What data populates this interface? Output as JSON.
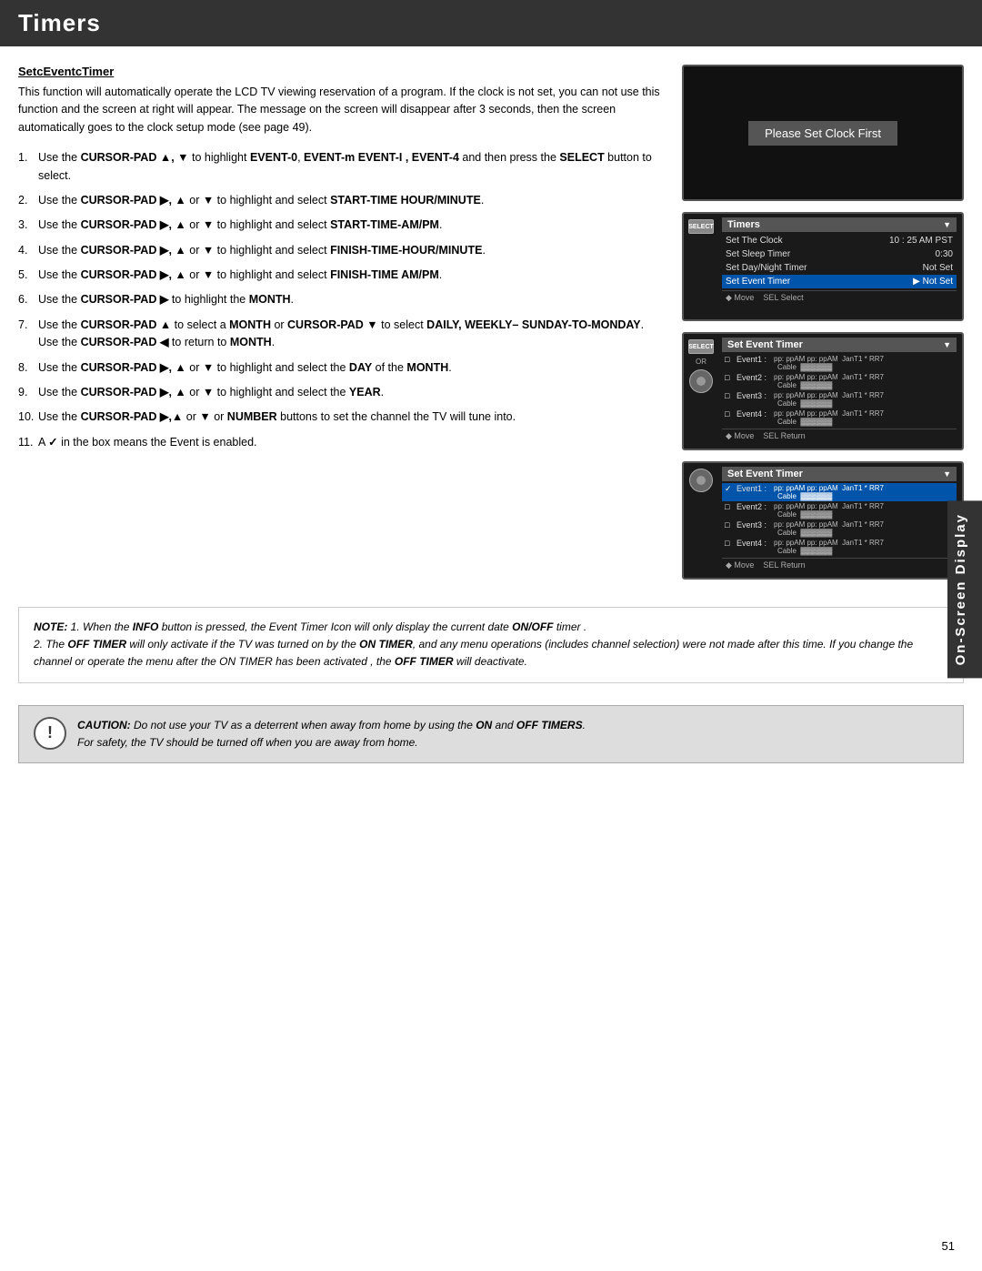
{
  "header": {
    "title": "Timers"
  },
  "sidebar": {
    "label": "On-Screen Display"
  },
  "section": {
    "title": "SetcEventcTimer",
    "intro": "This function will automatically operate the LCD TV viewing reservation of a program. If the clock is not set, you can not use this function and the screen at right will appear. The message on the screen will disappear after 3 seconds, then the screen automatically goes to the clock setup mode (see page 49)."
  },
  "steps": [
    {
      "num": "1.",
      "text_parts": [
        {
          "type": "normal",
          "text": "Use the "
        },
        {
          "type": "bold",
          "text": "CURSOR-PAD ▲, ▼"
        },
        {
          "type": "normal",
          "text": " to highlight "
        },
        {
          "type": "bold",
          "text": "EVENT-0"
        },
        {
          "type": "normal",
          "text": ", "
        },
        {
          "type": "bold",
          "text": "EVENT-m EVENT-I , EVENT-4"
        },
        {
          "type": "normal",
          "text": " and then press the "
        },
        {
          "type": "bold",
          "text": "SELECT"
        },
        {
          "type": "normal",
          "text": " button to select."
        }
      ]
    },
    {
      "num": "2.",
      "text_parts": [
        {
          "type": "normal",
          "text": "Use the "
        },
        {
          "type": "bold",
          "text": "CURSOR-PAD ▶, ▲"
        },
        {
          "type": "normal",
          "text": " or "
        },
        {
          "type": "bold",
          "text": "▼"
        },
        {
          "type": "normal",
          "text": " to highlight and select "
        },
        {
          "type": "bold",
          "text": "START-TIME HOUR/MINUTE"
        },
        {
          "type": "normal",
          "text": "."
        }
      ]
    },
    {
      "num": "3.",
      "text_parts": [
        {
          "type": "normal",
          "text": "Use the "
        },
        {
          "type": "bold",
          "text": "CURSOR-PAD ▶, ▲"
        },
        {
          "type": "normal",
          "text": " or "
        },
        {
          "type": "bold",
          "text": "▼"
        },
        {
          "type": "normal",
          "text": " to highlight and select "
        },
        {
          "type": "bold",
          "text": "START-TIME-AM/PM"
        },
        {
          "type": "normal",
          "text": "."
        }
      ]
    },
    {
      "num": "4.",
      "text_parts": [
        {
          "type": "normal",
          "text": "Use the "
        },
        {
          "type": "bold",
          "text": "CURSOR-PAD ▶, ▲"
        },
        {
          "type": "normal",
          "text": " or "
        },
        {
          "type": "bold",
          "text": "▼"
        },
        {
          "type": "normal",
          "text": " to highlight and select "
        },
        {
          "type": "bold",
          "text": "FINISH-TIME-HOUR/MINUTE"
        },
        {
          "type": "normal",
          "text": "."
        }
      ]
    },
    {
      "num": "5.",
      "text_parts": [
        {
          "type": "normal",
          "text": "Use the "
        },
        {
          "type": "bold",
          "text": "CURSOR-PAD ▶, ▲"
        },
        {
          "type": "normal",
          "text": " or "
        },
        {
          "type": "bold",
          "text": "▼"
        },
        {
          "type": "normal",
          "text": " to highlight and select "
        },
        {
          "type": "bold",
          "text": "FINISH-TIME AM/PM"
        },
        {
          "type": "normal",
          "text": "."
        }
      ]
    },
    {
      "num": "6.",
      "text_parts": [
        {
          "type": "normal",
          "text": "Use the "
        },
        {
          "type": "bold",
          "text": "CURSOR-PAD ▶"
        },
        {
          "type": "normal",
          "text": " to highlight the "
        },
        {
          "type": "bold",
          "text": "MONTH"
        },
        {
          "type": "normal",
          "text": "."
        }
      ]
    },
    {
      "num": "7.",
      "text_parts": [
        {
          "type": "normal",
          "text": "Use the "
        },
        {
          "type": "bold",
          "text": "CURSOR-PAD ▲"
        },
        {
          "type": "normal",
          "text": " to select a "
        },
        {
          "type": "bold",
          "text": "MONTH"
        },
        {
          "type": "normal",
          "text": " or "
        },
        {
          "type": "bold",
          "text": "CURSOR-PAD ▼"
        },
        {
          "type": "normal",
          "text": " to select "
        },
        {
          "type": "bold",
          "text": "DAILY, WEEKLY– SUNDAY-TO-MONDAY"
        },
        {
          "type": "normal",
          "text": ". Use the "
        },
        {
          "type": "bold",
          "text": "CURSOR-PAD ◀"
        },
        {
          "type": "normal",
          "text": " to return to "
        },
        {
          "type": "bold",
          "text": "MONTH"
        },
        {
          "type": "normal",
          "text": "."
        }
      ]
    },
    {
      "num": "8.",
      "text_parts": [
        {
          "type": "normal",
          "text": "Use the "
        },
        {
          "type": "bold",
          "text": "CURSOR-PAD ▶, ▲"
        },
        {
          "type": "normal",
          "text": " or "
        },
        {
          "type": "bold",
          "text": "▼"
        },
        {
          "type": "normal",
          "text": " to highlight and select the "
        },
        {
          "type": "bold",
          "text": "DAY"
        },
        {
          "type": "normal",
          "text": " of the "
        },
        {
          "type": "bold",
          "text": "MONTH"
        },
        {
          "type": "normal",
          "text": "."
        }
      ]
    },
    {
      "num": "9.",
      "text_parts": [
        {
          "type": "normal",
          "text": "Use the "
        },
        {
          "type": "bold",
          "text": "CURSOR-PAD ▶, ▲"
        },
        {
          "type": "normal",
          "text": " or "
        },
        {
          "type": "bold",
          "text": "▼"
        },
        {
          "type": "normal",
          "text": " to highlight and select the "
        },
        {
          "type": "bold",
          "text": "YEAR"
        },
        {
          "type": "normal",
          "text": "."
        }
      ]
    },
    {
      "num": "10.",
      "text_parts": [
        {
          "type": "normal",
          "text": "Use the "
        },
        {
          "type": "bold",
          "text": "CURSOR-PAD ▶,▲"
        },
        {
          "type": "normal",
          "text": " or "
        },
        {
          "type": "bold",
          "text": "▼"
        },
        {
          "type": "normal",
          "text": " or "
        },
        {
          "type": "bold",
          "text": "NUMBER"
        },
        {
          "type": "normal",
          "text": " buttons to set the channel the TV will tune into."
        }
      ]
    },
    {
      "num": "11.",
      "text_parts": [
        {
          "type": "normal",
          "text": "A "
        },
        {
          "type": "bold",
          "text": "✓"
        },
        {
          "type": "normal",
          "text": " in the box means the Event is enabled."
        }
      ]
    }
  ],
  "screens": {
    "screen1": {
      "message": "Please Set Clock First"
    },
    "screen2": {
      "title": "Timers",
      "rows": [
        {
          "label": "Set The Clock",
          "value": "10 : 25 AM PST",
          "highlighted": false
        },
        {
          "label": "Set Sleep Timer",
          "value": "0:30",
          "highlighted": false
        },
        {
          "label": "Set Day/Night Timer",
          "value": "Not Set",
          "highlighted": false
        },
        {
          "label": "Set Event Timer",
          "value": "Not Set",
          "highlighted": true
        }
      ],
      "footer": "◆ Move   SEL Select"
    },
    "screen3": {
      "title": "Set Event Timer",
      "events": [
        {
          "check": "□",
          "label": "Event1",
          "time": "pp: ppAM pp: ppAM  JanT1 * RR7",
          "source": "Cable  ▓▓▓▓▓▓",
          "highlighted": false
        },
        {
          "check": "□",
          "label": "Event2",
          "time": "pp: ppAM pp: ppAM  JanT1 * RR7",
          "source": "Cable  ▓▓▓▓▓▓",
          "highlighted": false
        },
        {
          "check": "□",
          "label": "Event3",
          "time": "pp: ppAM pp: ppAM  JanT1 * RR7",
          "source": "Cable  ▓▓▓▓▓▓",
          "highlighted": false
        },
        {
          "check": "□",
          "label": "Event4",
          "time": "pp: ppAM pp: ppAM  JanT1 * RR7",
          "source": "Cable  ▓▓▓▓▓▓",
          "highlighted": false
        }
      ],
      "footer": "◆ Move   SEL Return"
    },
    "screen4": {
      "title": "Set Event Timer",
      "events": [
        {
          "check": "✓",
          "label": "Event1",
          "time": "pp: ppAM pp: ppAM  JanT1 * RR7",
          "source": "Cable  ▓▓▓▓▓▓",
          "highlighted": true
        },
        {
          "check": "□",
          "label": "Event2",
          "time": "pp: ppAM pp: ppAM  JanT1 * RR7",
          "source": "Cable  ▓▓▓▓▓▓",
          "highlighted": false
        },
        {
          "check": "□",
          "label": "Event3",
          "time": "pp: ppAM pp: ppAM  JanT1 * RR7",
          "source": "Cable  ▓▓▓▓▓▓",
          "highlighted": false
        },
        {
          "check": "□",
          "label": "Event4",
          "time": "pp: ppAM pp: ppAM  JanT1 * RR7",
          "source": "Cable  ▓▓▓▓▓▓",
          "highlighted": false
        }
      ],
      "footer": "◆ Move   SEL Return"
    }
  },
  "note": {
    "prefix": "NOTE:",
    "lines": [
      "1. When the INFO button is pressed, the Event Timer Icon will only display the current date ON/OFF timer .",
      "2. The OFF TIMER will only activate if the TV was turned on by the ON TIMER, and any menu operations (includes channel selection) were not made after this time. If you change the channel or operate the menu after the ON TIMER has been activated , the OFF TIMER will deactivate."
    ]
  },
  "caution": {
    "prefix": "CAUTION:",
    "text": "Do not use your TV as a deterrent when away from home by using the ON and OFF TIMERS. For safety, the TV should be turned off when you are away from home."
  },
  "page_number": "51"
}
